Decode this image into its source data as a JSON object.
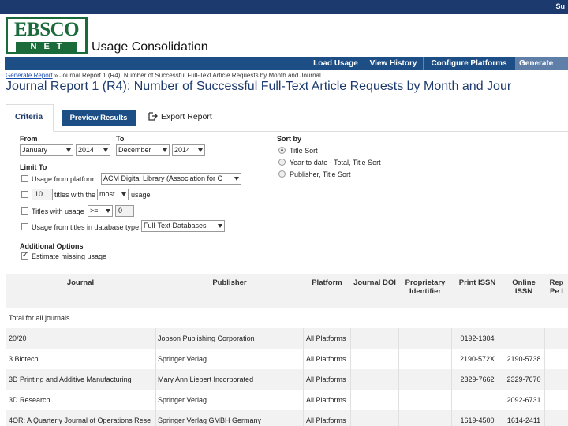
{
  "topbar": {
    "user": "Su"
  },
  "header": {
    "logo_top": "EBSCO",
    "logo_bottom": "NET",
    "app_title": "Usage Consolidation"
  },
  "nav": {
    "items": [
      {
        "label": "Load Usage"
      },
      {
        "label": "View History"
      },
      {
        "label": "Configure Platforms"
      },
      {
        "label": "Generate Rep"
      }
    ]
  },
  "breadcrumb": {
    "link": "Generate Report",
    "rest": " » Journal Report 1 (R4): Number of Successful Full-Text Article Requests by Month and Journal"
  },
  "page_title": "Journal Report 1 (R4): Number of Successful Full-Text Article Requests by Month and Jour",
  "tabs": {
    "criteria": "Criteria",
    "preview": "Preview Results",
    "export": "Export Report"
  },
  "criteria": {
    "from_label": "From",
    "from_month": "January",
    "from_year": "2014",
    "to_label": "To",
    "to_month": "December",
    "to_year": "2014",
    "limit_label": "Limit To",
    "usage_platform_label": "Usage from platform",
    "platform_value": "ACM Digital Library (Association for C",
    "titles_count": "10",
    "titles_with_label": "titles with the",
    "most_value": "most",
    "usage_label": "usage",
    "titles_usage_label": "Titles with usage",
    "op_value": ">=",
    "usage_value": "0",
    "db_type_label": "Usage from titles in database type:",
    "db_type_value": "Full-Text Databases",
    "additional_label": "Additional Options",
    "estimate_label": "Estimate missing usage"
  },
  "sort": {
    "label": "Sort by",
    "options": [
      "Title Sort",
      "Year to date - Total, Title Sort",
      "Publisher, Title Sort"
    ]
  },
  "table": {
    "headers": {
      "journal": "Journal",
      "publisher": "Publisher",
      "platform": "Platform",
      "doi": "Journal DOI",
      "prop": "Proprietary Identifier",
      "print": "Print ISSN",
      "online": "Online ISSN",
      "rep": "Rep Pe I"
    },
    "total_label": "Total for all journals",
    "rows": [
      {
        "journal": "20/20",
        "publisher": "Jobson Publishing Corporation",
        "platform": "All Platforms",
        "print": "0192-1304",
        "online": ""
      },
      {
        "journal": "3 Biotech",
        "publisher": "Springer Verlag",
        "platform": "All Platforms",
        "print": "2190-572X",
        "online": "2190-5738"
      },
      {
        "journal": "3D Printing and Additive Manufacturing",
        "publisher": "Mary Ann Liebert Incorporated",
        "platform": "All Platforms",
        "print": "2329-7662",
        "online": "2329-7670"
      },
      {
        "journal": "3D Research",
        "publisher": "Springer Verlag",
        "platform": "All Platforms",
        "print": "",
        "online": "2092-6731"
      },
      {
        "journal": "4OR: A Quarterly Journal of Operations Rese",
        "publisher": "Springer Verlag GMBH Germany",
        "platform": "All Platforms",
        "print": "1619-4500",
        "online": "1614-2411"
      }
    ]
  }
}
